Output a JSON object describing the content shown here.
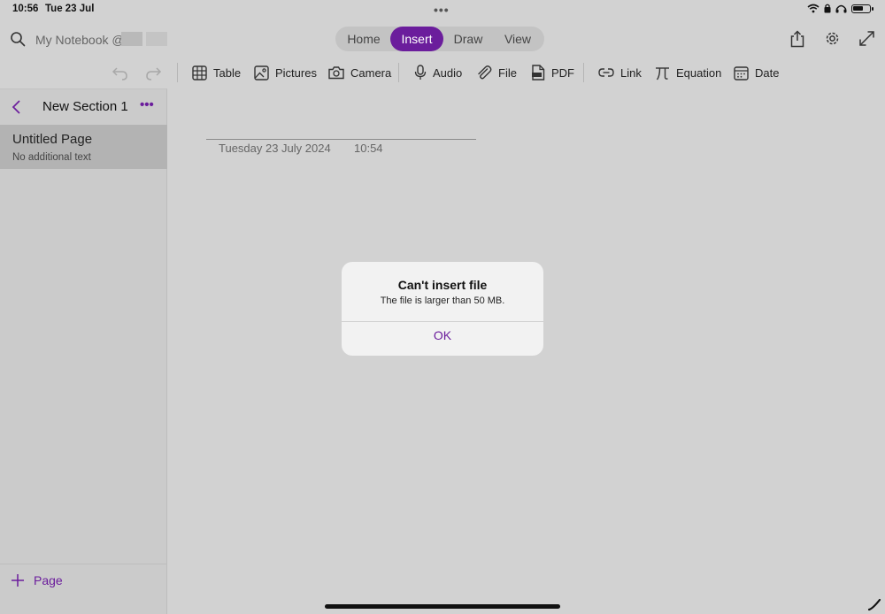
{
  "status_bar": {
    "time": "10:56",
    "date": "Tue 23 Jul",
    "multitask_dots": "•••",
    "battery_level": 0.65
  },
  "header": {
    "notebook_name": "My Notebook @",
    "tabs": [
      {
        "label": "Home",
        "active": false
      },
      {
        "label": "Insert",
        "active": true
      },
      {
        "label": "Draw",
        "active": false
      },
      {
        "label": "View",
        "active": false
      }
    ],
    "right_icons": [
      "share-icon",
      "gear-icon",
      "expand-icon"
    ]
  },
  "toolbar": {
    "undo_icon": "undo-icon",
    "redo_icon": "redo-icon",
    "items": [
      {
        "label": "Table",
        "icon": "table-icon"
      },
      {
        "label": "Pictures",
        "icon": "picture-icon"
      },
      {
        "label": "Camera",
        "icon": "camera-icon"
      },
      {
        "label": "Audio",
        "icon": "microphone-icon"
      },
      {
        "label": "File",
        "icon": "paperclip-icon"
      },
      {
        "label": "PDF",
        "icon": "pdf-icon"
      },
      {
        "label": "Link",
        "icon": "link-icon"
      },
      {
        "label": "Equation",
        "icon": "pi-icon"
      },
      {
        "label": "Date",
        "icon": "calendar-icon"
      }
    ]
  },
  "sidebar": {
    "section_title": "New Section 1",
    "more_label": "•••",
    "pages": [
      {
        "title": "Untitled Page",
        "subtitle": "No additional text",
        "selected": true
      }
    ],
    "add_page_label": "Page"
  },
  "page": {
    "date": "Tuesday 23 July 2024",
    "time": "10:54"
  },
  "dialog": {
    "title": "Can't insert file",
    "message": "The file is larger than 50 MB.",
    "ok_label": "OK"
  },
  "colors": {
    "accent": "#6b1d9c",
    "background": "#d2d2d2",
    "sidebar": "#cbcbcb",
    "selected_page": "#b3b3b3",
    "dialog": "#f2f2f2"
  }
}
